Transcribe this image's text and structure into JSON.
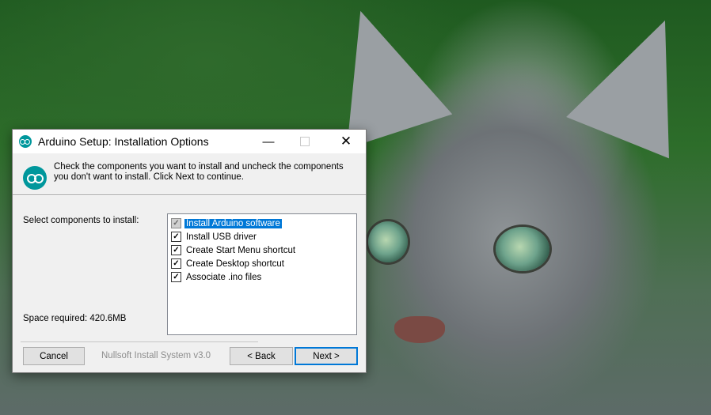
{
  "window": {
    "title": "Arduino Setup: Installation Options",
    "minimize_glyph": "—",
    "close_glyph": "✕"
  },
  "header": {
    "description": "Check the components you want to install and uncheck the components you don't want to install. Click Next to continue."
  },
  "components": {
    "label": "Select components to install:",
    "items": [
      {
        "label": "Install Arduino software",
        "checked": true,
        "disabled": true,
        "selected": true
      },
      {
        "label": "Install USB driver",
        "checked": true,
        "disabled": false,
        "selected": false
      },
      {
        "label": "Create Start Menu shortcut",
        "checked": true,
        "disabled": false,
        "selected": false
      },
      {
        "label": "Create Desktop shortcut",
        "checked": true,
        "disabled": false,
        "selected": false
      },
      {
        "label": "Associate .ino files",
        "checked": true,
        "disabled": false,
        "selected": false
      }
    ],
    "space_required": "Space required: 420.6MB"
  },
  "footer": {
    "cancel_label": "Cancel",
    "brand": "Nullsoft Install System v3.0",
    "back_label": "< Back",
    "next_label": "Next >"
  },
  "colors": {
    "accent": "#0078d7",
    "arduino_teal": "#00979c"
  },
  "icons": {
    "checkmark": "✓"
  }
}
